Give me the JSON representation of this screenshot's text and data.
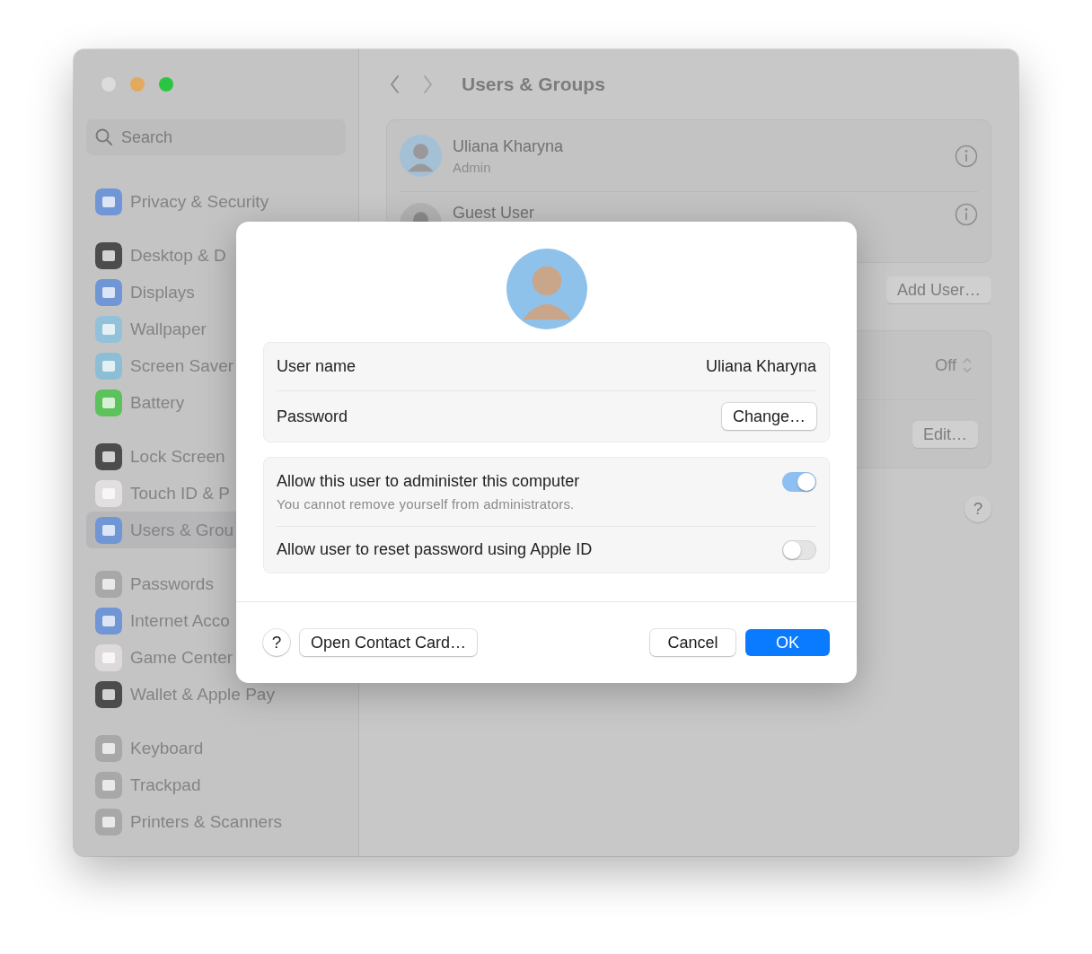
{
  "window": {
    "traffic_lights": [
      {
        "color": "#dddbdc"
      },
      {
        "color": "#e3a95c"
      },
      {
        "color": "#2ac641"
      }
    ]
  },
  "sidebar": {
    "search": {
      "placeholder": "Search"
    },
    "groups": [
      {
        "items": [
          {
            "label": "Privacy & Security",
            "selected": false,
            "color": "#7096d6"
          }
        ]
      },
      {
        "items": [
          {
            "label": "Desktop & D",
            "selected": false,
            "color": "#4d4c4d"
          },
          {
            "label": "Displays",
            "selected": false,
            "color": "#7096d6"
          },
          {
            "label": "Wallpaper",
            "selected": false,
            "color": "#92c2da"
          },
          {
            "label": "Screen Saver",
            "selected": false,
            "color": "#8cbfd6"
          },
          {
            "label": "Battery",
            "selected": false,
            "color": "#5cc25c"
          }
        ]
      },
      {
        "items": [
          {
            "label": "Lock Screen",
            "selected": false,
            "color": "#4d4c4d"
          },
          {
            "label": "Touch ID & P",
            "selected": false,
            "color": "#e3dfe1"
          },
          {
            "label": "Users & Grou",
            "selected": true,
            "color": "#7096d6"
          }
        ]
      },
      {
        "items": [
          {
            "label": "Passwords",
            "selected": false,
            "color": "#a9a8a9"
          },
          {
            "label": "Internet Acco",
            "selected": false,
            "color": "#7096d6"
          },
          {
            "label": "Game Center",
            "selected": false,
            "color": "#dedadc"
          },
          {
            "label": "Wallet & Apple Pay",
            "selected": false,
            "color": "#4d4c4d"
          }
        ]
      },
      {
        "items": [
          {
            "label": "Keyboard",
            "selected": false,
            "color": "#a9a8a9"
          },
          {
            "label": "Trackpad",
            "selected": false,
            "color": "#a9a8a9"
          },
          {
            "label": "Printers & Scanners",
            "selected": false,
            "color": "#a9a8a9"
          }
        ]
      }
    ]
  },
  "header": {
    "title": "Users & Groups"
  },
  "users": [
    {
      "name": "Uliana Kharyna",
      "role": "Admin"
    },
    {
      "name": "Guest User"
    }
  ],
  "user_buttons": [
    "Add User…"
  ],
  "settings": [
    {
      "kind": "popup",
      "value": "Off"
    },
    {
      "kind": "button",
      "label": "Edit…"
    }
  ],
  "help": "?",
  "dialog": {
    "fields": [
      {
        "kind": "value",
        "label": "User name",
        "value": "Uliana Kharyna"
      },
      {
        "kind": "button",
        "label": "Password",
        "button": "Change…"
      }
    ],
    "toggles": [
      {
        "label": "Allow this user to administer this computer",
        "note": "You cannot remove yourself from administrators.",
        "on": true
      },
      {
        "label": "Allow user to reset password using Apple ID",
        "on": false
      }
    ],
    "footer": {
      "help": "?",
      "contact": "Open Contact Card…",
      "cancel": "Cancel",
      "ok": "OK"
    }
  }
}
